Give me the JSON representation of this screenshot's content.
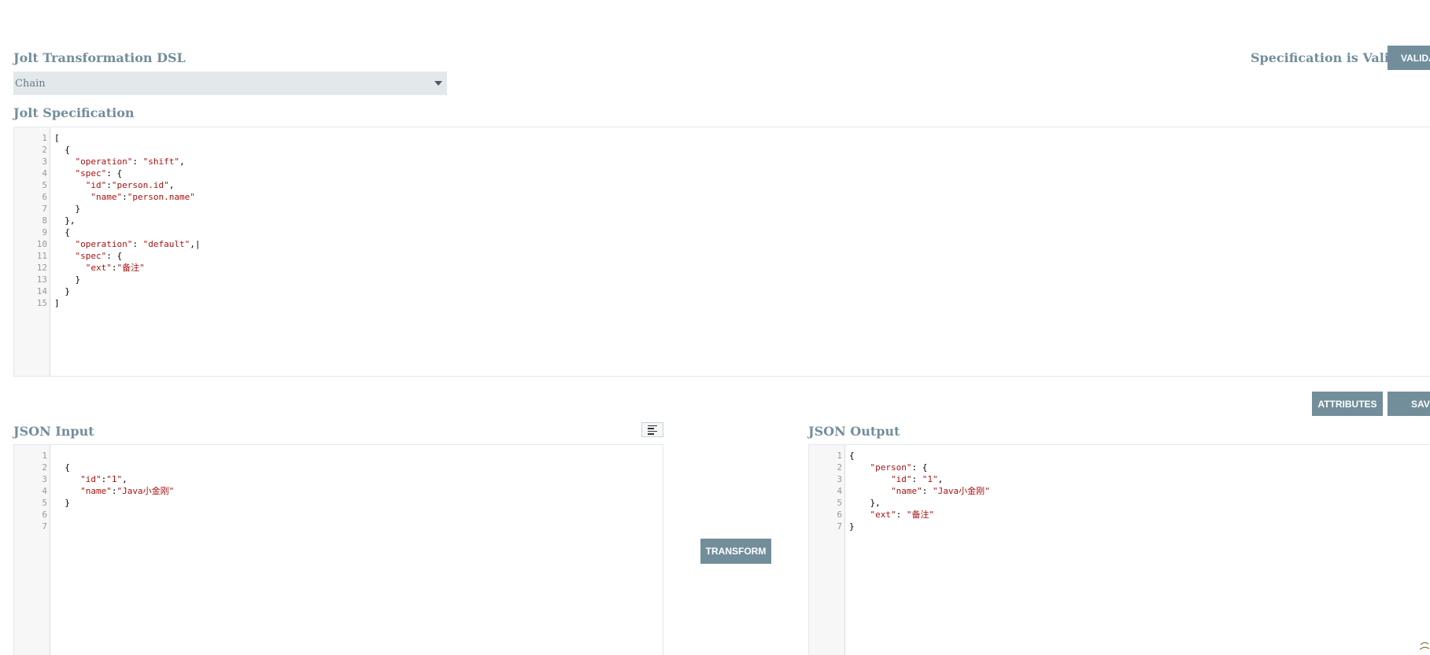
{
  "header": {
    "dsl_label": "Jolt Transformation DSL",
    "validity_text": "Specification is Valid",
    "validate_label": "VALIDATE"
  },
  "dsl_select": {
    "value": "Chain"
  },
  "spec": {
    "label": "Jolt Specification",
    "lines": [
      {
        "n": "1",
        "code": "["
      },
      {
        "n": "2",
        "code": "  {"
      },
      {
        "n": "3",
        "code": "    \"operation\": \"shift\","
      },
      {
        "n": "4",
        "code": "    \"spec\": {"
      },
      {
        "n": "5",
        "code": "      \"id\":\"person.id\","
      },
      {
        "n": "6",
        "code": "       \"name\":\"person.name\""
      },
      {
        "n": "7",
        "code": "    }"
      },
      {
        "n": "8",
        "code": "  },"
      },
      {
        "n": "9",
        "code": "  {"
      },
      {
        "n": "10",
        "code": "    \"operation\": \"default\",|"
      },
      {
        "n": "11",
        "code": "    \"spec\": {"
      },
      {
        "n": "12",
        "code": "      \"ext\":\"备注\""
      },
      {
        "n": "13",
        "code": "    }"
      },
      {
        "n": "14",
        "code": "  }"
      },
      {
        "n": "15",
        "code": "]"
      }
    ]
  },
  "actions": {
    "attributes_label": "ATTRIBUTES",
    "save_label": "SAVE",
    "transform_label": "TRANSFORM"
  },
  "input": {
    "label": "JSON Input",
    "format_icon": "align-left-icon",
    "lines": [
      {
        "n": "1",
        "code": ""
      },
      {
        "n": "2",
        "code": "  {"
      },
      {
        "n": "3",
        "code": "     \"id\":\"1\","
      },
      {
        "n": "4",
        "code": "     \"name\":\"Java小金刚\""
      },
      {
        "n": "5",
        "code": "  }"
      },
      {
        "n": "6",
        "code": ""
      },
      {
        "n": "7",
        "code": ""
      }
    ]
  },
  "output": {
    "label": "JSON Output",
    "lines": [
      {
        "n": "1",
        "code": "{"
      },
      {
        "n": "2",
        "code": "    \"person\": {"
      },
      {
        "n": "3",
        "code": "        \"id\": \"1\","
      },
      {
        "n": "4",
        "code": "        \"name\": \"Java小金刚\""
      },
      {
        "n": "5",
        "code": "    },"
      },
      {
        "n": "6",
        "code": "    \"ext\": \"备注\""
      },
      {
        "n": "7",
        "code": "}"
      }
    ]
  },
  "colors": {
    "accent": "#728e9b",
    "string": "#aa1111",
    "gutter": "#f7f7f7"
  }
}
